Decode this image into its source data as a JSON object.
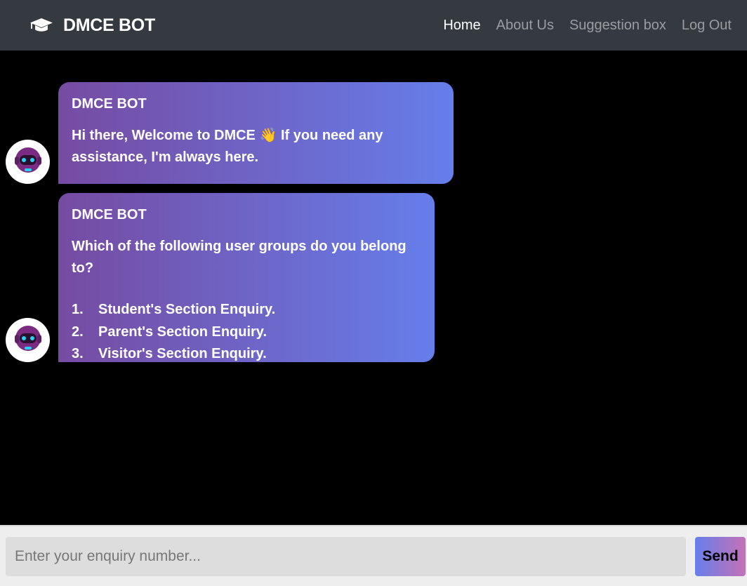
{
  "navbar": {
    "brand_icon": "graduation-cap-icon",
    "brand_name": "DMCE BOT",
    "links": [
      {
        "label": "Home",
        "active": true
      },
      {
        "label": "About Us",
        "active": false
      },
      {
        "label": "Suggestion box",
        "active": false
      },
      {
        "label": "Log Out",
        "active": false
      }
    ]
  },
  "chat": {
    "messages": [
      {
        "sender": "DMCE BOT",
        "avatar_icon": "robot-icon",
        "text_before": "Hi there, Welcome to DMCE",
        "emoji": "👋",
        "text_after": "If you need any assistance, I'm always here."
      },
      {
        "sender": "DMCE BOT",
        "avatar_icon": "robot-icon",
        "text": "Which of the following user groups do you belong to?",
        "options": [
          {
            "num": "1.",
            "label": "Student's Section Enquiry."
          },
          {
            "num": "2.",
            "label": "Parent's Section Enquiry."
          },
          {
            "num": "3.",
            "label": "Visitor's Section Enquiry."
          }
        ]
      }
    ]
  },
  "input_bar": {
    "placeholder": "Enter your enquiry number...",
    "value": "",
    "send_label": "Send"
  },
  "colors": {
    "navbar_bg": "#343a40",
    "bubble_gradient_start": "#764ba2",
    "bubble_gradient_end": "#667eea",
    "send_gradient_end": "#c471b8"
  }
}
